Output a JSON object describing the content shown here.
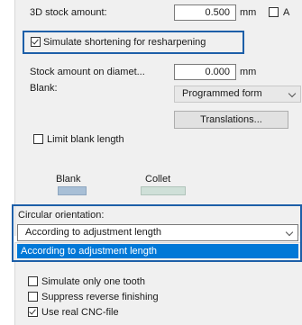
{
  "stock_amount": {
    "label": "3D stock amount:",
    "value": "0.500",
    "unit": "mm",
    "a_label": "A",
    "a_checked": false
  },
  "simulate_shortening": {
    "label": "Simulate shortening for resharpening",
    "checked": true
  },
  "stock_diameter": {
    "label": "Stock amount on diamet...",
    "value": "0.000",
    "unit": "mm"
  },
  "blank": {
    "label": "Blank:",
    "selected": "Programmed form"
  },
  "translations_button": "Translations...",
  "limit_blank_length": {
    "label": "Limit blank length",
    "checked": false
  },
  "colors": {
    "blank_label": "Blank",
    "collet_label": "Collet",
    "blank_swatch": "#a8bfd6",
    "collet_swatch": "#cfe0d8",
    "accent": "#1d5fa8",
    "selection": "#0078d7"
  },
  "circular_orientation": {
    "label": "Circular orientation:",
    "selected": "According to adjustment length",
    "dropdown_options": [
      "According to adjustment length"
    ]
  },
  "options": [
    {
      "label": "Simulate only one tooth",
      "checked": false
    },
    {
      "label": "Suppress reverse finishing",
      "checked": false
    },
    {
      "label": "Use real CNC-file",
      "checked": true
    }
  ]
}
